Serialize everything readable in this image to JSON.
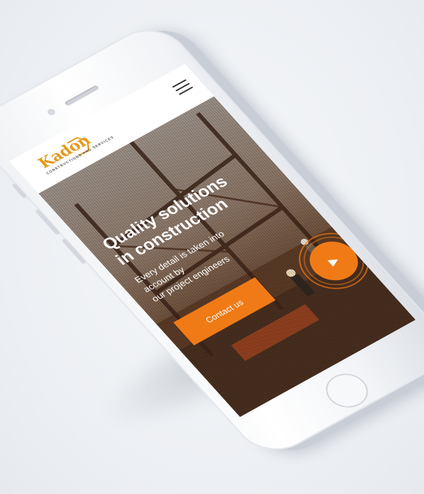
{
  "brand": {
    "name": "Kadon",
    "tagline": "CONSTRUCTIONS AND SERVICES",
    "accent": "#f07b16",
    "logo_color": "#e39a1d"
  },
  "header": {
    "menu_icon": "hamburger-icon"
  },
  "hero": {
    "title_line1": "Quality solutions",
    "title_line2": "in construction",
    "text_line1": "Every detail is taken into",
    "text_line2": "account by",
    "text_line3": "our project engineers",
    "cta_label": "Contact us",
    "play_icon": "play-icon"
  }
}
